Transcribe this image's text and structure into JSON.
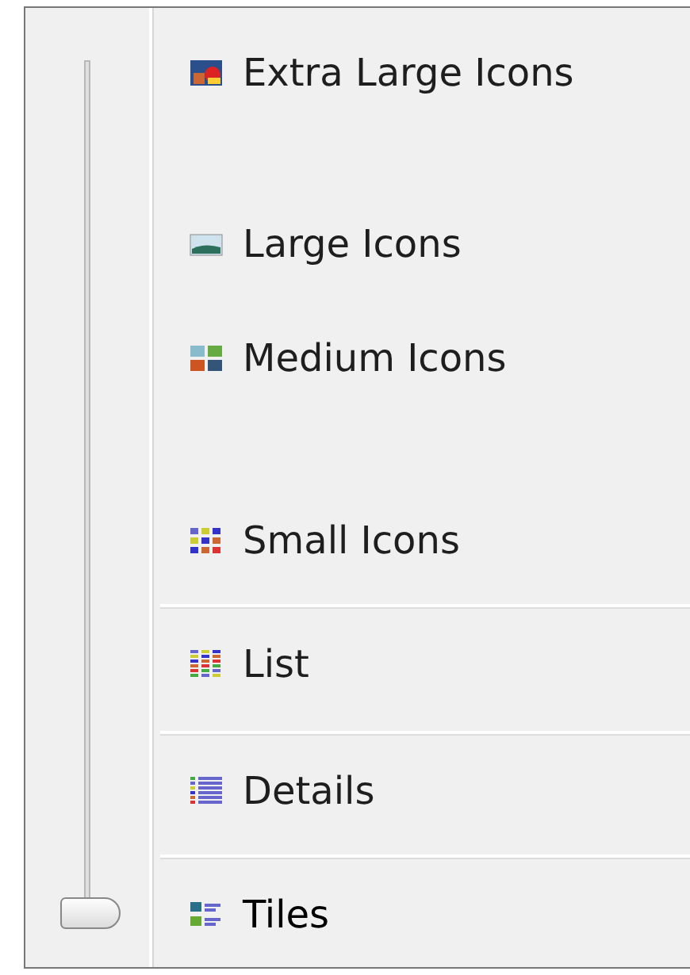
{
  "items": [
    {
      "label": "Extra Large Icons",
      "kind": "scaled",
      "selected": false
    },
    {
      "label": "Large Icons",
      "kind": "scaled",
      "selected": false
    },
    {
      "label": "Medium Icons",
      "kind": "scaled",
      "selected": false
    },
    {
      "label": "Small Icons",
      "kind": "scaled",
      "selected": false
    },
    {
      "label": "List",
      "kind": "fixed",
      "selected": false
    },
    {
      "label": "Details",
      "kind": "fixed",
      "selected": false
    },
    {
      "label": "Tiles",
      "kind": "fixed",
      "selected": true
    }
  ]
}
